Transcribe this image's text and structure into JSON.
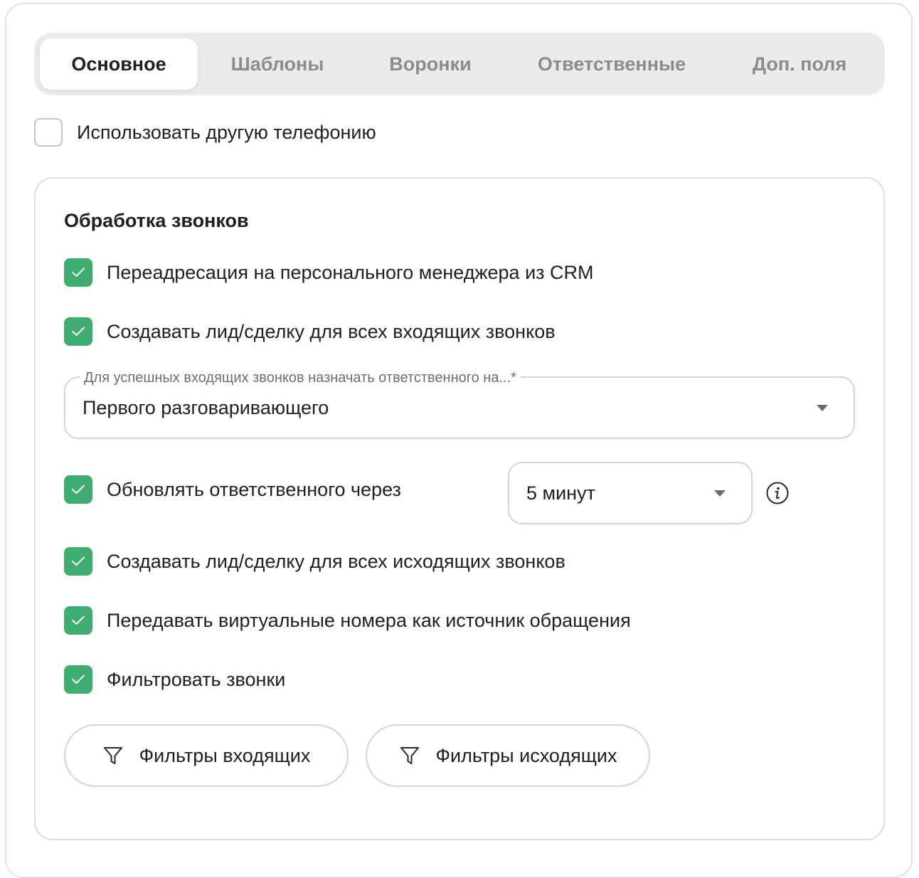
{
  "tabs": [
    {
      "label": "Основное",
      "active": true
    },
    {
      "label": "Шаблоны",
      "active": false
    },
    {
      "label": "Воронки",
      "active": false
    },
    {
      "label": "Ответственные",
      "active": false
    },
    {
      "label": "Доп. поля",
      "active": false
    }
  ],
  "use_other_telephony": {
    "label": "Использовать другую телефонию",
    "checked": false
  },
  "call_processing": {
    "title": "Обработка звонков",
    "redirect_personal_manager": {
      "label": "Переадресация на персонального менеджера из CRM",
      "checked": true
    },
    "create_lead_incoming": {
      "label": "Создавать лид/сделку для всех входящих звонков",
      "checked": true
    },
    "assign_responsible_select": {
      "label": "Для успешных входящих звонков назначать ответственного на...*",
      "value": "Первого разговаривающего",
      "icon": "chevron-down-icon"
    },
    "update_responsible": {
      "label": "Обновлять ответственного через",
      "checked": true,
      "select_value": "5 минут",
      "info_icon": "info-icon"
    },
    "create_lead_outgoing": {
      "label": "Создавать лид/сделку для всех исходящих звонков",
      "checked": true
    },
    "pass_virtual_numbers": {
      "label": "Передавать виртуальные номера как источник обращения",
      "checked": true
    },
    "filter_calls": {
      "label": "Фильтровать звонки",
      "checked": true
    },
    "buttons": {
      "incoming_filters": {
        "label": "Фильтры входящих",
        "icon": "filter-icon"
      },
      "outgoing_filters": {
        "label": "Фильтры исходящих",
        "icon": "filter-icon"
      }
    }
  },
  "colors": {
    "accent_green": "#3fad6f",
    "tab_bar_bg": "#ebebeb",
    "border": "#d4d4d4"
  }
}
